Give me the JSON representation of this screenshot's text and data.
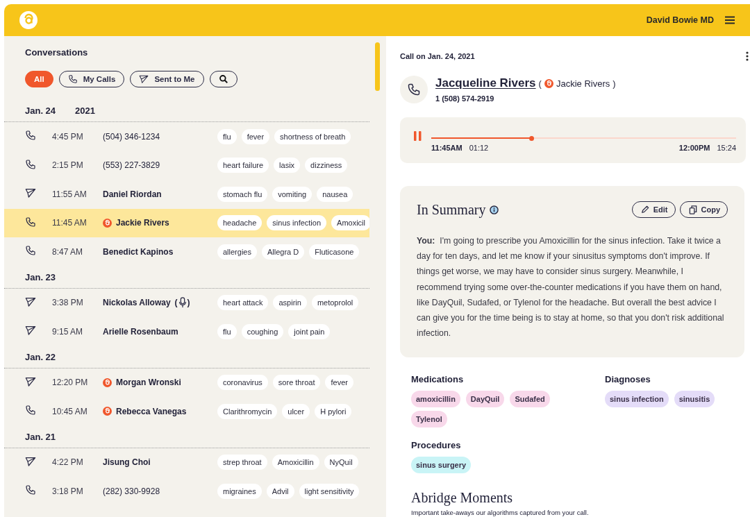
{
  "header": {
    "user": "David Bowie MD"
  },
  "conversations": {
    "title": "Conversations",
    "filters": [
      {
        "kind": "text",
        "label": "All",
        "selected": true
      },
      {
        "kind": "call",
        "label": "My Calls",
        "selected": false
      },
      {
        "kind": "sent",
        "label": "Sent to Me",
        "selected": false
      },
      {
        "kind": "search",
        "selected": false
      }
    ],
    "groups": [
      {
        "date": "Jan. 24",
        "year": "2021",
        "rows": [
          {
            "kind": "call",
            "time": "4:45 PM",
            "caller": "(504) 346-1234",
            "named": false,
            "abridge": false,
            "voice_note": false,
            "selected": false,
            "tags": [
              "flu",
              "fever",
              "shortness of breath"
            ]
          },
          {
            "kind": "call",
            "time": "2:15 PM",
            "caller": "(553) 227-3829",
            "named": false,
            "abridge": false,
            "voice_note": false,
            "selected": false,
            "tags": [
              "heart failure",
              "lasix",
              "dizziness"
            ]
          },
          {
            "kind": "sent",
            "time": "11:55 AM",
            "caller": "Daniel Riordan",
            "named": true,
            "abridge": false,
            "voice_note": false,
            "selected": false,
            "tags": [
              "stomach flu",
              "vomiting",
              "nausea"
            ]
          },
          {
            "kind": "call",
            "time": "11:45 AM",
            "caller": "Jackie Rivers",
            "named": true,
            "abridge": true,
            "voice_note": false,
            "selected": true,
            "tags": [
              "headache",
              "sinus infection",
              "Amoxicil"
            ]
          },
          {
            "kind": "call",
            "time": "8:47 AM",
            "caller": "Benedict Kapinos",
            "named": true,
            "abridge": false,
            "voice_note": false,
            "selected": false,
            "tags": [
              "allergies",
              "Allegra D",
              "Fluticasone"
            ]
          }
        ]
      },
      {
        "date": "Jan. 23",
        "rows": [
          {
            "kind": "sent",
            "time": "3:38 PM",
            "caller": "Nickolas Alloway",
            "named": true,
            "abridge": false,
            "voice_note": true,
            "note_brackets": [
              "(",
              ")"
            ],
            "selected": false,
            "tags": [
              "heart attack",
              "aspirin",
              "metoprolol"
            ]
          },
          {
            "kind": "sent",
            "time": "9:15 AM",
            "caller": "Arielle Rosenbaum",
            "named": true,
            "abridge": false,
            "voice_note": false,
            "selected": false,
            "tags": [
              "flu",
              "coughing",
              "joint pain"
            ]
          }
        ]
      },
      {
        "date": "Jan. 22",
        "rows": [
          {
            "kind": "sent",
            "time": "12:20 PM",
            "caller": "Morgan Wronski",
            "named": true,
            "abridge": true,
            "voice_note": false,
            "selected": false,
            "tags": [
              "coronavirus",
              "sore throat",
              "fever"
            ]
          },
          {
            "kind": "call",
            "time": "10:45 AM",
            "caller": "Rebecca Vanegas",
            "named": true,
            "abridge": true,
            "voice_note": false,
            "selected": false,
            "tags": [
              "Clarithromycin",
              "ulcer",
              "H pylori"
            ]
          }
        ]
      },
      {
        "date": "Jan. 21",
        "rows": [
          {
            "kind": "sent",
            "time": "4:22 PM",
            "caller": "Jisung Choi",
            "named": true,
            "abridge": false,
            "voice_note": false,
            "selected": false,
            "tags": [
              "strep throat",
              "Amoxicillin",
              "NyQuil"
            ]
          },
          {
            "kind": "call",
            "time": "3:18 PM",
            "caller": "(282) 330-9928",
            "named": false,
            "abridge": false,
            "voice_note": false,
            "selected": false,
            "tags": [
              "migraines",
              "Advil",
              "light sensitivity"
            ]
          }
        ]
      }
    ]
  },
  "detail": {
    "heading": "Call on Jan. 24, 2021",
    "contact": {
      "kind": "call",
      "name": "Jacqueline Rivers",
      "brackets": [
        "(",
        ")"
      ],
      "alias": "Jackie Rivers",
      "phone": "1 (508) 574-2919"
    },
    "player": {
      "playing": true,
      "level": 0.33,
      "start_time": "11:45AM",
      "elapsed": "01:12",
      "end_time": "12:00PM",
      "duration": "15:24"
    },
    "summary": {
      "title": "In Summary",
      "actions": [
        {
          "kind": "edit",
          "label": "Edit"
        },
        {
          "kind": "copy",
          "label": "Copy"
        }
      ],
      "text": "**You:**  I'm going to prescribe you Amoxicillin for the sinus infection. Take it twice a day for ten days, and let me know if your sinusitus symptoms don't improve. If things get worse, we may have to consider sinus surgery. Meanwhile, I recommend trying some over-the-counter medications if you have them on hand, like DayQuil, Sudafed, or Tylenol for the headache. But overall the best advice I can give you for the time being is to stay at home, so that you don't risk additional infection."
    },
    "sections": [
      {
        "title": "Medications",
        "color": "#f8d8ea",
        "chips": [
          "amoxicillin",
          "DayQuil",
          "Sudafed",
          "Tylenol"
        ]
      },
      {
        "title": "Diagnoses",
        "color": "#e4dcf8",
        "chips": [
          "sinus infection",
          "sinusitis"
        ]
      },
      {
        "title": "Procedures",
        "color": "#c9f4f6",
        "chips": [
          "sinus surgery"
        ]
      }
    ],
    "moments": {
      "title": "Abridge Moments",
      "subtitle": "Important take-aways our algorithms captured from your call."
    }
  }
}
